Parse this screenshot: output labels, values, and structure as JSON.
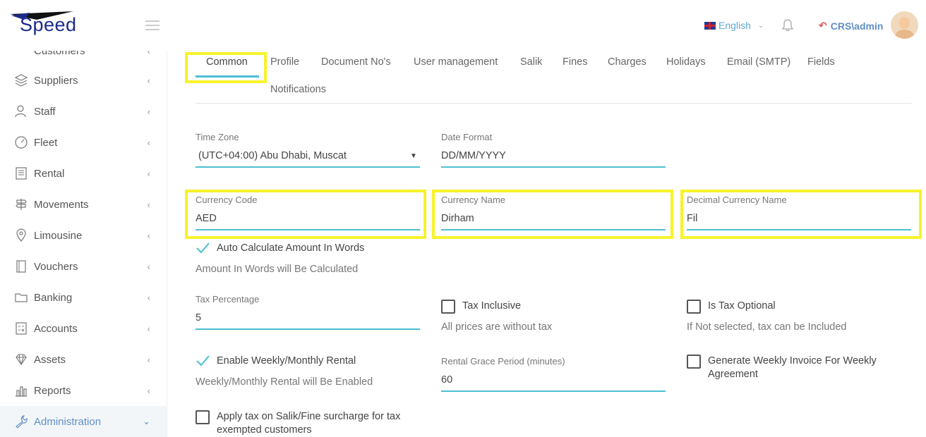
{
  "header": {
    "logo_text": "Speed",
    "language": "English",
    "username": "CRS\\admin",
    "colors": {
      "accent": "#4dbfd3",
      "brand": "#1a2a8c",
      "link": "#5f8fc7",
      "highlight": "#f7f32a"
    }
  },
  "sidebar": {
    "partial_item": "Customers",
    "items": [
      {
        "label": "Suppliers",
        "icon": "layers-icon"
      },
      {
        "label": "Staff",
        "icon": "users-icon"
      },
      {
        "label": "Fleet",
        "icon": "speedometer-icon"
      },
      {
        "label": "Rental",
        "icon": "book-icon"
      },
      {
        "label": "Movements",
        "icon": "signpost-icon"
      },
      {
        "label": "Limousine",
        "icon": "map-pin-icon"
      },
      {
        "label": "Vouchers",
        "icon": "notebook-icon"
      },
      {
        "label": "Banking",
        "icon": "folder-icon"
      },
      {
        "label": "Accounts",
        "icon": "calculator-icon"
      },
      {
        "label": "Assets",
        "icon": "diamond-icon"
      },
      {
        "label": "Reports",
        "icon": "bar-chart-icon"
      },
      {
        "label": "Administration",
        "icon": "wrench-icon",
        "active": true
      }
    ]
  },
  "tabs": [
    "Common",
    "Profile",
    "Document No's",
    "User management",
    "Salik",
    "Fines",
    "Charges",
    "Holidays",
    "Email (SMTP)",
    "Fields",
    "Notifications"
  ],
  "form": {
    "time_zone": {
      "label": "Time Zone",
      "value": "(UTC+04:00) Abu Dhabi, Muscat"
    },
    "date_format": {
      "label": "Date Format",
      "value": "DD/MM/YYYY"
    },
    "currency_code": {
      "label": "Currency Code",
      "value": "AED"
    },
    "currency_name": {
      "label": "Currency Name",
      "value": "Dirham"
    },
    "decimal_currency_name": {
      "label": "Decimal Currency Name",
      "value": "Fil"
    },
    "auto_calc": {
      "label": "Auto Calculate Amount In Words",
      "checked": true,
      "hint": "Amount In Words will Be Calculated"
    },
    "tax_percentage": {
      "label": "Tax Percentage",
      "value": "5"
    },
    "tax_inclusive": {
      "label": "Tax Inclusive",
      "checked": false,
      "hint": "All prices are without tax"
    },
    "is_tax_optional": {
      "label": "Is Tax Optional",
      "checked": false,
      "hint": "If Not selected, tax can be Included"
    },
    "weekly_monthly": {
      "label": "Enable Weekly/Monthly Rental",
      "checked": true,
      "hint": "Weekly/Monthly Rental will Be Enabled"
    },
    "rental_grace": {
      "label": "Rental Grace Period (minutes)",
      "value": "60"
    },
    "weekly_invoice": {
      "label_line1": "Generate Weekly Invoice For Weekly",
      "label_line2": "Agreement",
      "checked": false
    },
    "salik_tax": {
      "label_line1": "Apply tax on Salik/Fine surcharge for tax",
      "label_line2": "exempted customers",
      "checked": false
    }
  }
}
